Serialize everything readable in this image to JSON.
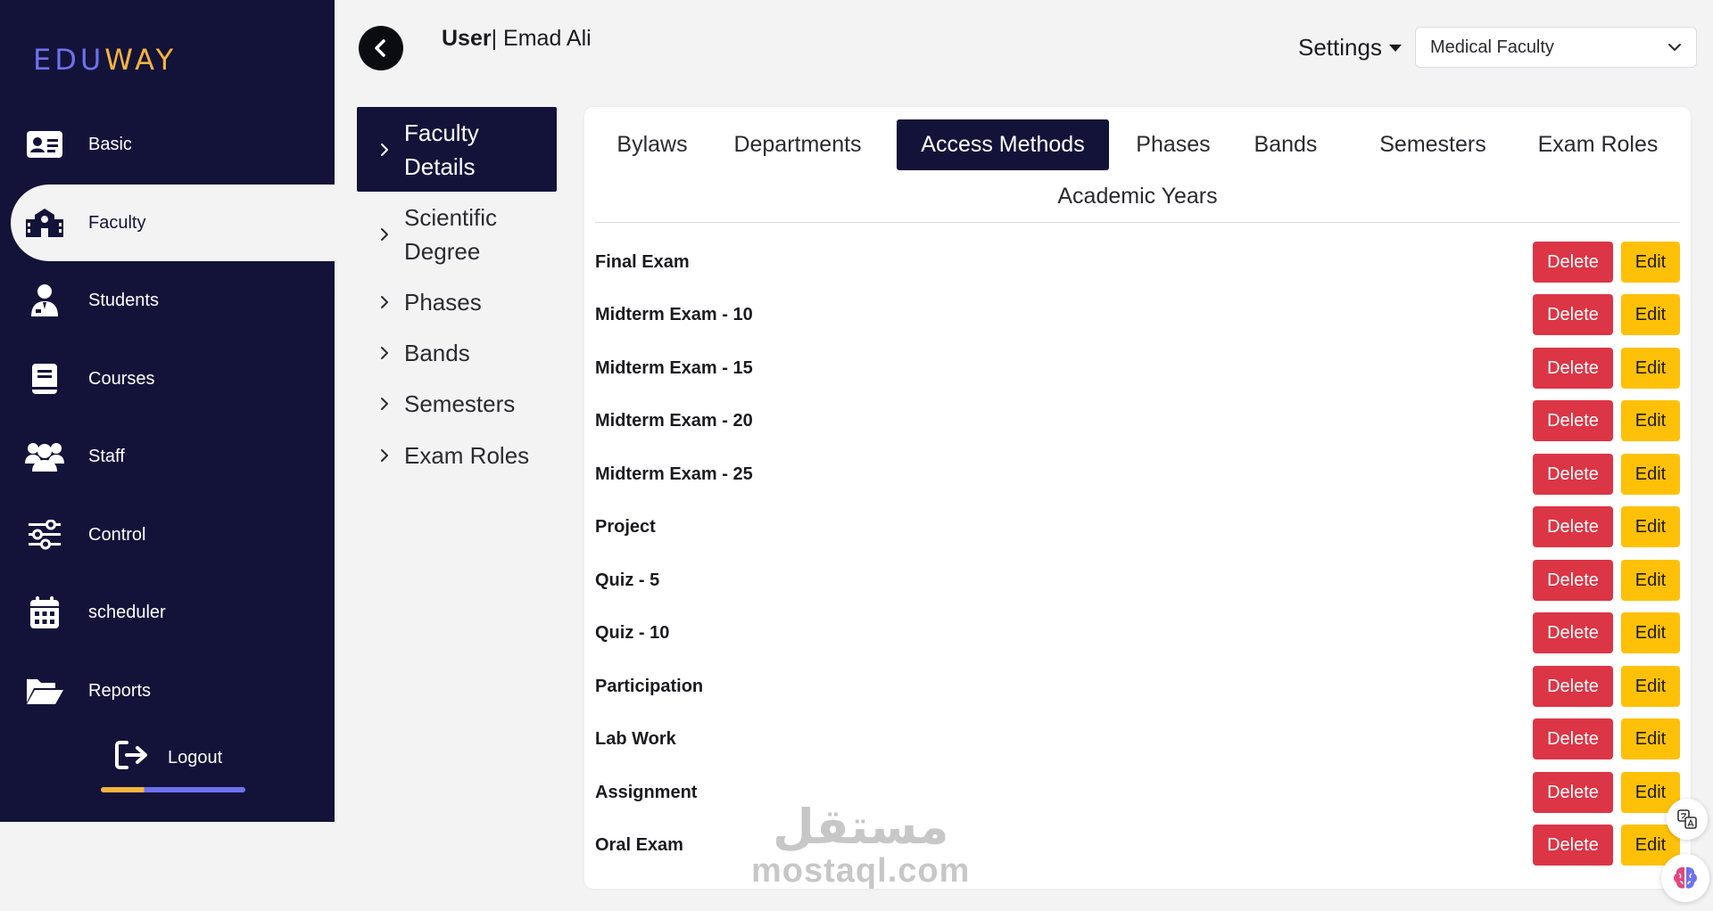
{
  "brand": {
    "part1": "EDU",
    "part2": "WAY"
  },
  "sidebar": {
    "items": [
      {
        "label": "Basic",
        "icon": "id-card-icon"
      },
      {
        "label": "Faculty",
        "icon": "school-icon"
      },
      {
        "label": "Students",
        "icon": "student-icon"
      },
      {
        "label": "Courses",
        "icon": "book-icon"
      },
      {
        "label": "Staff",
        "icon": "users-icon"
      },
      {
        "label": "Control",
        "icon": "sliders-icon"
      },
      {
        "label": "scheduler",
        "icon": "calendar-icon"
      },
      {
        "label": "Reports",
        "icon": "folder-open-icon"
      }
    ],
    "active_index": 1,
    "logout_label": "Logout"
  },
  "header": {
    "user_prefix": "User",
    "user_name": "| Emad Ali",
    "settings_label": "Settings",
    "faculty_select": "Medical Faculty"
  },
  "subnav": {
    "active": {
      "line1": "Faculty",
      "line2": "Details"
    },
    "items": [
      {
        "line1": "Scientific",
        "line2": "Degree"
      },
      {
        "label": "Phases"
      },
      {
        "label": "Bands"
      },
      {
        "label": "Semesters"
      },
      {
        "label": "Exam Roles"
      }
    ]
  },
  "tabs": [
    {
      "label": "Bylaws"
    },
    {
      "label": "Departments"
    },
    {
      "label": "Access Methods",
      "active": true
    },
    {
      "label": "Phases"
    },
    {
      "label": "Bands"
    },
    {
      "label": "Semesters"
    },
    {
      "label": "Exam Roles"
    },
    {
      "label": "Academic Years"
    }
  ],
  "rows": [
    {
      "label": "Final Exam"
    },
    {
      "label": "Midterm Exam - 10"
    },
    {
      "label": "Midterm Exam - 15"
    },
    {
      "label": "Midterm Exam - 20"
    },
    {
      "label": "Midterm Exam - 25"
    },
    {
      "label": "Project"
    },
    {
      "label": "Quiz - 5"
    },
    {
      "label": "Quiz - 10"
    },
    {
      "label": "Participation"
    },
    {
      "label": "Lab Work"
    },
    {
      "label": "Assignment"
    },
    {
      "label": "Oral Exam"
    }
  ],
  "row_actions": {
    "delete_label": "Delete",
    "edit_label": "Edit"
  },
  "watermark": {
    "arabic": "مستقل",
    "latin": "mostaql.com"
  },
  "colors": {
    "sidebar_bg": "#13133a",
    "accent_blue": "#6f72ec",
    "accent_orange": "#f6b43e",
    "delete_red": "#dc3545",
    "edit_yellow": "#ffc107"
  }
}
